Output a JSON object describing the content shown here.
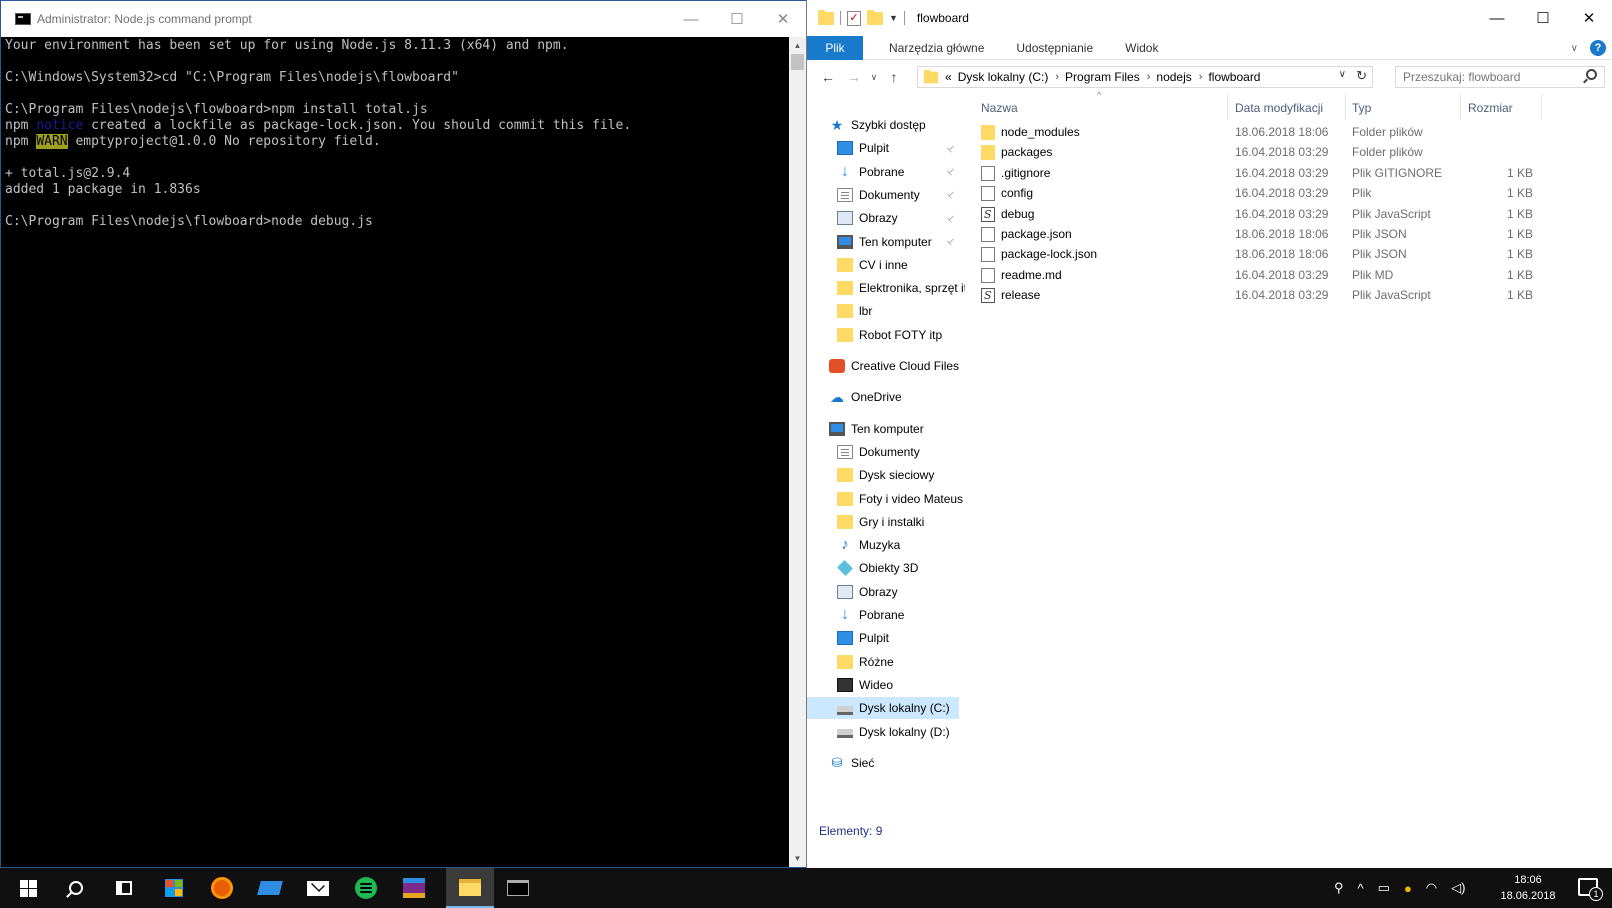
{
  "cmd": {
    "title": "Administrator: Node.js command prompt",
    "lines": [
      {
        "text": "Your environment has been set up for using Node.js 8.11.3 (x64) and npm."
      },
      {
        "text": ""
      },
      {
        "text": "C:\\Windows\\System32>cd \"C:\\Program Files\\nodejs\\flowboard\""
      },
      {
        "text": ""
      },
      {
        "text": "C:\\Program Files\\nodejs\\flowboard>npm install total.js"
      },
      {
        "pre": "npm ",
        "tag": "notice",
        "tag_style": "notice",
        "post": " created a lockfile as package-lock.json. You should commit this file."
      },
      {
        "pre": "npm ",
        "tag": "WARN",
        "tag_style": "warn",
        "post": " emptyproject@1.0.0 No repository field."
      },
      {
        "text": ""
      },
      {
        "text": "+ total.js@2.9.4"
      },
      {
        "text": "added 1 package in 1.836s"
      },
      {
        "text": ""
      },
      {
        "text": "C:\\Program Files\\nodejs\\flowboard>node debug.js"
      }
    ],
    "buttons": {
      "minimize": "—",
      "maximize": "☐",
      "close": "✕"
    }
  },
  "explorer": {
    "title": "flowboard",
    "buttons": {
      "minimize": "—",
      "maximize": "☐",
      "close": "✕"
    },
    "ribbon_tabs": [
      "Plik",
      "Narzędzia główne",
      "Udostępnianie",
      "Widok"
    ],
    "breadcrumb": {
      "overflow": "«",
      "parts": [
        "Dysk lokalny (C:)",
        "Program Files",
        "nodejs",
        "flowboard"
      ]
    },
    "search": {
      "placeholder": "Przeszukaj: flowboard"
    },
    "nav": [
      {
        "label": "Szybki dostęp",
        "icon": "star-icon",
        "indent": 0
      },
      {
        "label": "Pulpit",
        "icon": "desktop-icon",
        "indent": 1,
        "pinned": true
      },
      {
        "label": "Pobrane",
        "icon": "download-icon",
        "indent": 1,
        "pinned": true
      },
      {
        "label": "Dokumenty",
        "icon": "document-icon",
        "indent": 1,
        "pinned": true
      },
      {
        "label": "Obrazy",
        "icon": "picture-icon",
        "indent": 1,
        "pinned": true
      },
      {
        "label": "Ten komputer",
        "icon": "computer-icon",
        "indent": 1,
        "pinned": true
      },
      {
        "label": "CV i inne",
        "icon": "folder-icon",
        "indent": 1
      },
      {
        "label": "Elektronika, sprzęt it",
        "icon": "folder-icon",
        "indent": 1
      },
      {
        "label": "lbr",
        "icon": "folder-icon",
        "indent": 1
      },
      {
        "label": "Robot FOTY itp",
        "icon": "folder-icon",
        "indent": 1
      },
      {
        "label": "Creative Cloud Files",
        "icon": "creative-cloud-icon",
        "indent": 0,
        "gap": true
      },
      {
        "label": "OneDrive",
        "icon": "onedrive-icon",
        "indent": 0,
        "gap": true
      },
      {
        "label": "Ten komputer",
        "icon": "computer-icon",
        "indent": 0,
        "gap": true
      },
      {
        "label": "Dokumenty",
        "icon": "document-icon",
        "indent": 1
      },
      {
        "label": "Dysk sieciowy",
        "icon": "folder-icon",
        "indent": 1
      },
      {
        "label": "Foty i video Mateus",
        "icon": "folder-icon",
        "indent": 1
      },
      {
        "label": "Gry i instalki",
        "icon": "folder-icon",
        "indent": 1
      },
      {
        "label": "Muzyka",
        "icon": "music-icon",
        "indent": 1
      },
      {
        "label": "Obiekty 3D",
        "icon": "objects-3d-icon",
        "indent": 1
      },
      {
        "label": "Obrazy",
        "icon": "picture-icon",
        "indent": 1
      },
      {
        "label": "Pobrane",
        "icon": "download-icon",
        "indent": 1
      },
      {
        "label": "Pulpit",
        "icon": "desktop-icon",
        "indent": 1
      },
      {
        "label": "Różne",
        "icon": "folder-icon",
        "indent": 1
      },
      {
        "label": "Wideo",
        "icon": "video-icon",
        "indent": 1
      },
      {
        "label": "Dysk lokalny (C:)",
        "icon": "drive-icon",
        "indent": 1,
        "selected": true
      },
      {
        "label": "Dysk lokalny (D:)",
        "icon": "drive-icon",
        "indent": 1
      },
      {
        "label": "Sieć",
        "icon": "network-icon",
        "indent": 0,
        "gap": true
      }
    ],
    "columns": {
      "name": "Nazwa",
      "date": "Data modyfikacji",
      "type": "Typ",
      "size": "Rozmiar"
    },
    "files": [
      {
        "name": "node_modules",
        "date": "18.06.2018 18:06",
        "type": "Folder plików",
        "size": "",
        "kind": "folder"
      },
      {
        "name": "packages",
        "date": "16.04.2018 03:29",
        "type": "Folder plików",
        "size": "",
        "kind": "folder"
      },
      {
        "name": ".gitignore",
        "date": "16.04.2018 03:29",
        "type": "Plik GITIGNORE",
        "size": "1 KB",
        "kind": "file"
      },
      {
        "name": "config",
        "date": "16.04.2018 03:29",
        "type": "Plik",
        "size": "1 KB",
        "kind": "file"
      },
      {
        "name": "debug",
        "date": "16.04.2018 03:29",
        "type": "Plik JavaScript",
        "size": "1 KB",
        "kind": "js"
      },
      {
        "name": "package.json",
        "date": "18.06.2018 18:06",
        "type": "Plik JSON",
        "size": "1 KB",
        "kind": "file"
      },
      {
        "name": "package-lock.json",
        "date": "18.06.2018 18:06",
        "type": "Plik JSON",
        "size": "1 KB",
        "kind": "file"
      },
      {
        "name": "readme.md",
        "date": "16.04.2018 03:29",
        "type": "Plik MD",
        "size": "1 KB",
        "kind": "file"
      },
      {
        "name": "release",
        "date": "16.04.2018 03:29",
        "type": "Plik JavaScript",
        "size": "1 KB",
        "kind": "js"
      }
    ],
    "status": "Elementy: 9"
  },
  "taskbar": {
    "apps": [
      {
        "name": "start-button",
        "icon": "windows-logo-icon"
      },
      {
        "name": "search-button",
        "icon": "search-icon"
      },
      {
        "name": "task-view-button",
        "icon": "task-view-icon"
      },
      {
        "name": "store-app",
        "icon": "store-icon"
      },
      {
        "name": "firefox-app",
        "icon": "firefox-icon"
      },
      {
        "name": "device-app",
        "icon": "laptop-icon"
      },
      {
        "name": "mail-app",
        "icon": "mail-icon"
      },
      {
        "name": "spotify-app",
        "icon": "spotify-icon"
      },
      {
        "name": "winrar-app",
        "icon": "winrar-icon"
      },
      {
        "name": "explorer-app",
        "icon": "folder-icon",
        "active": true
      },
      {
        "name": "cmd-app",
        "icon": "terminal-icon"
      }
    ],
    "clock": {
      "time": "18:06",
      "date": "18.06.2018"
    },
    "notification_count": "1"
  }
}
